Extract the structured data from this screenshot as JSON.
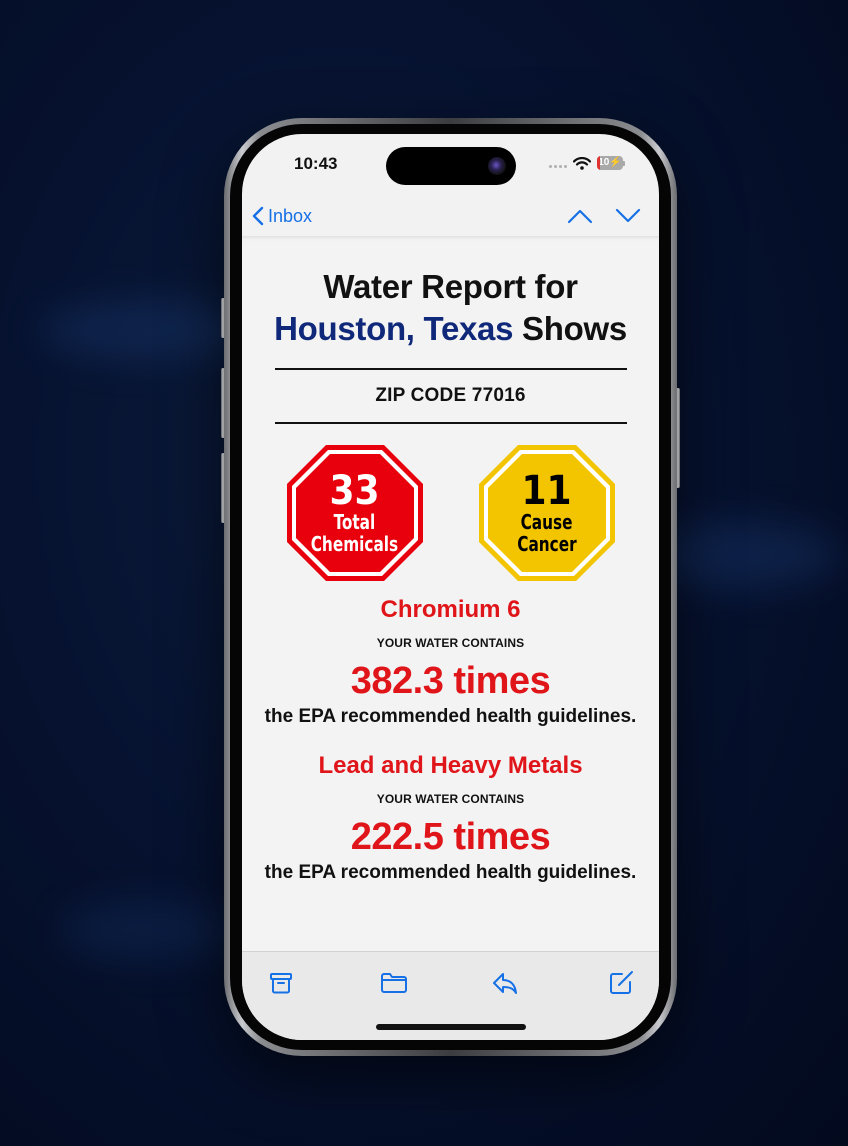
{
  "status_bar": {
    "time": "10:43",
    "battery_level": "10",
    "icons": [
      "cellular-dots-icon",
      "wifi-icon",
      "battery-charging-icon"
    ]
  },
  "mail_nav": {
    "back_label": "Inbox",
    "icons": [
      "chevron-left-icon",
      "chevron-up-icon",
      "chevron-down-icon"
    ]
  },
  "email": {
    "title_line1": "Water Report for",
    "city": "Houston, Texas",
    "title_suffix": "Shows",
    "zip_code": "ZIP CODE 77016",
    "signs": [
      {
        "number": "33",
        "line1": "Total",
        "line2": "Chemicals",
        "color": "#e8000d"
      },
      {
        "number": "11",
        "line1": "Cause",
        "line2": "Cancer",
        "color": "#f2c500"
      }
    ],
    "findings": [
      {
        "contaminant": "Chromium 6",
        "lead_text": "YOUR WATER CONTAINS",
        "multiplier": "382.3 times",
        "trailing_text": "the EPA recommended health guidelines."
      },
      {
        "contaminant": "Lead and Heavy Metals",
        "lead_text": "YOUR WATER CONTAINS",
        "multiplier": "222.5 times",
        "trailing_text": "the EPA recommended health guidelines."
      }
    ]
  },
  "toolbar": {
    "items": [
      {
        "icon": "archive-icon",
        "label": "Archive"
      },
      {
        "icon": "folder-icon",
        "label": "Move"
      },
      {
        "icon": "reply-icon",
        "label": "Reply"
      },
      {
        "icon": "compose-icon",
        "label": "Compose"
      }
    ]
  },
  "colors": {
    "accent": "#1670e6",
    "city_blue": "#10287a",
    "alert_red": "#e0151a"
  }
}
